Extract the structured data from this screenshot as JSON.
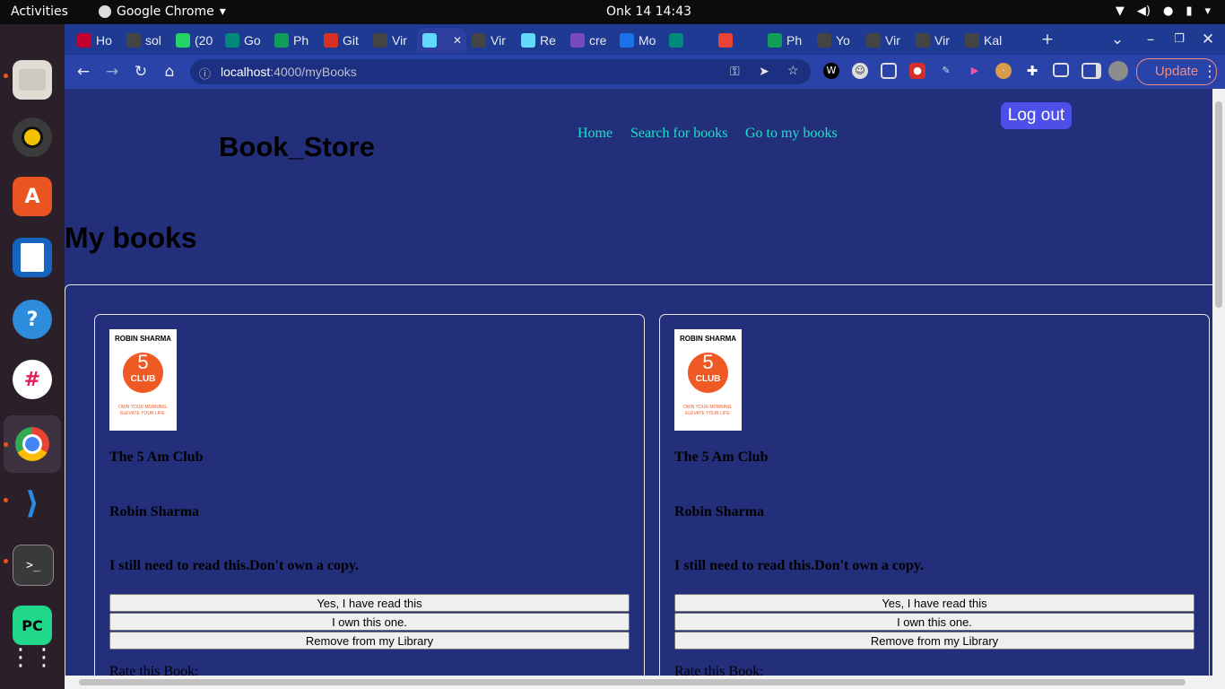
{
  "topbar": {
    "activities": "Activities",
    "app_name": "Google Chrome",
    "clock": "Onk 14  14:43"
  },
  "browser": {
    "tabs": [
      {
        "label": "Ho",
        "icon": "angular-icon",
        "color": "#c3002f"
      },
      {
        "label": "sol",
        "icon": "github-icon",
        "color": "#444"
      },
      {
        "label": "(20",
        "icon": "whatsapp-icon",
        "color": "#25d366"
      },
      {
        "label": "Go",
        "icon": "meet-icon",
        "color": "#00897b"
      },
      {
        "label": "Ph",
        "icon": "sheets-icon",
        "color": "#0f9d58"
      },
      {
        "label": "Git",
        "icon": "git-icon",
        "color": "#d93025"
      },
      {
        "label": "Vir",
        "icon": "github-icon",
        "color": "#444"
      },
      {
        "label": "",
        "icon": "react-icon",
        "color": "#61dafb",
        "active": true
      },
      {
        "label": "Vir",
        "icon": "github-icon",
        "color": "#444"
      },
      {
        "label": "Re",
        "icon": "react-icon",
        "color": "#61dafb"
      },
      {
        "label": "cre",
        "icon": "redux-icon",
        "color": "#764abc"
      },
      {
        "label": "Mo",
        "icon": "calendar-icon",
        "color": "#1a73e8"
      },
      {
        "label": "",
        "icon": "meet-icon",
        "color": "#00897b"
      },
      {
        "label": "",
        "icon": "record-icon",
        "color": "#ea4335"
      },
      {
        "label": "Ph",
        "icon": "sheets-icon",
        "color": "#0f9d58"
      },
      {
        "label": "Yo",
        "icon": "github-icon",
        "color": "#444"
      },
      {
        "label": "Vir",
        "icon": "github-icon",
        "color": "#444"
      },
      {
        "label": "Vir",
        "icon": "github-icon",
        "color": "#444"
      },
      {
        "label": "Kal",
        "icon": "github-icon",
        "color": "#444"
      }
    ],
    "url_host": "localhost",
    "url_path": ":4000/myBooks",
    "update_label": "Update"
  },
  "site": {
    "brand": "Book_Store",
    "nav": [
      "Home",
      "Search for books",
      "Go to my books"
    ],
    "logout": "Log out",
    "page_title": "My books"
  },
  "books": [
    {
      "cover": {
        "author": "ROBIN SHARMA",
        "big": "5",
        "sub": "CLUB",
        "tag": "OWN YOUR MORNING. ELEVATE YOUR LIFE."
      },
      "title": "The 5 Am Club",
      "author": "Robin Sharma",
      "status": "I still need to read this.Don't own a copy.",
      "buttons": [
        "Yes, I have read this",
        "I own this one.",
        "Remove from my Library"
      ],
      "rate_label": "Rate this Book:"
    },
    {
      "cover": {
        "author": "ROBIN SHARMA",
        "big": "5",
        "sub": "CLUB",
        "tag": "OWN YOUR MORNING. ELEVATE YOUR LIFE."
      },
      "title": "The 5 Am Club",
      "author": "Robin Sharma",
      "status": "I still need to read this.Don't own a copy.",
      "buttons": [
        "Yes, I have read this",
        "I own this one.",
        "Remove from my Library"
      ],
      "rate_label": "Rate this Book:"
    }
  ],
  "colors": {
    "page_bg": "#232f7b",
    "nav_link": "#19e3c9",
    "logout_bg": "#4c4fe8",
    "tabstrip": "#1f3a93"
  }
}
